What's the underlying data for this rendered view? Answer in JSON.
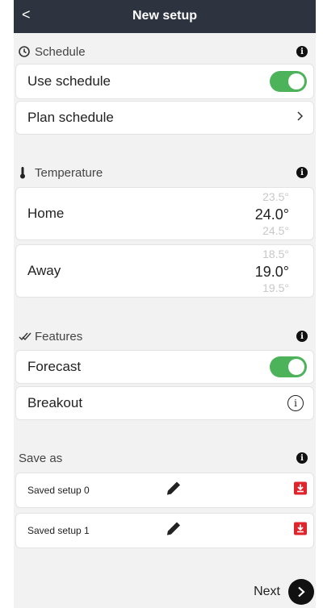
{
  "header": {
    "back_icon": "chevron-left-icon",
    "back_glyph": "<",
    "title": "New setup"
  },
  "schedule": {
    "title": "Schedule",
    "use_schedule": {
      "label": "Use schedule",
      "enabled": true
    },
    "plan_schedule": {
      "label": "Plan schedule"
    }
  },
  "temperature": {
    "title": "Temperature",
    "home": {
      "label": "Home",
      "above": "23.5°",
      "current": "24.0°",
      "below": "24.5°"
    },
    "away": {
      "label": "Away",
      "above": "18.5°",
      "current": "19.0°",
      "below": "19.5°"
    }
  },
  "features": {
    "title": "Features",
    "forecast": {
      "label": "Forecast",
      "enabled": true
    },
    "breakout": {
      "label": "Breakout"
    }
  },
  "save_as": {
    "title": "Save as",
    "items": [
      {
        "label": "Saved setup 0"
      },
      {
        "label": "Saved setup 1"
      }
    ]
  },
  "footer": {
    "next_label": "Next"
  },
  "colors": {
    "header_bg": "#2d3440",
    "toggle_on": "#4cb35a",
    "save_icon": "#e0242b",
    "page_bg": "#f2f2f2"
  }
}
